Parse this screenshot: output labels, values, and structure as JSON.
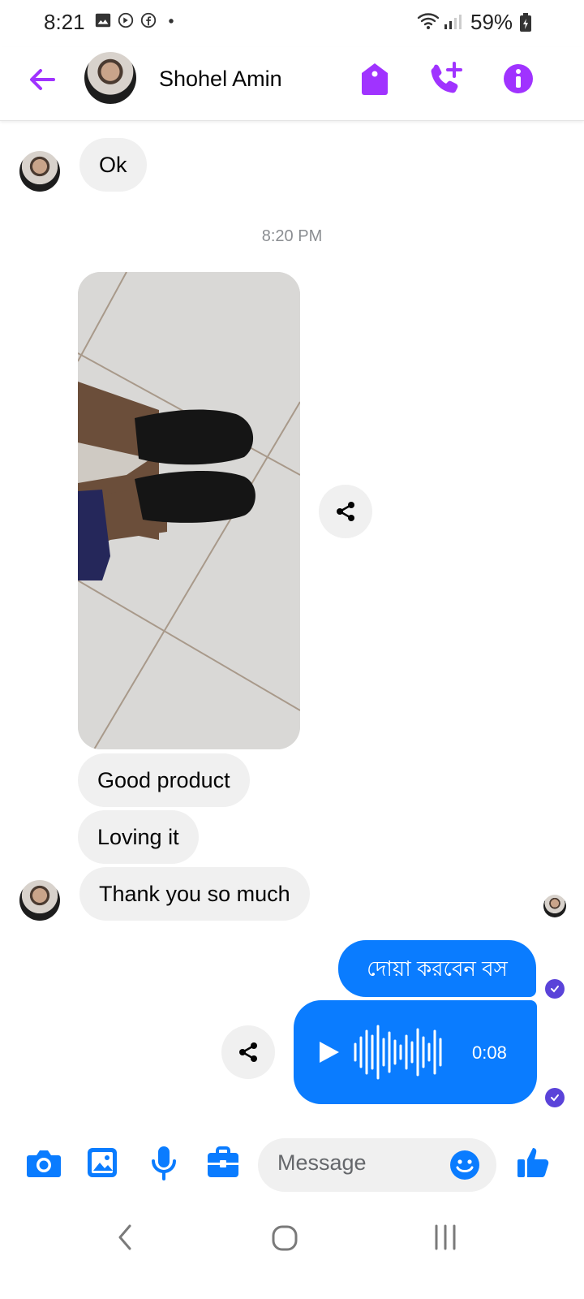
{
  "status_bar": {
    "time": "8:21",
    "battery": "59%"
  },
  "header": {
    "contact_name": "Shohel Amin"
  },
  "messages": [
    {
      "text": "Ok"
    },
    {
      "timestamp": "8:20 PM"
    },
    {
      "text": "Good product"
    },
    {
      "text": "Loving it"
    },
    {
      "text": "Thank you so much"
    },
    {
      "text": "দোয়া করবেন বস"
    },
    {
      "audio_duration": "0:08"
    }
  ],
  "composer": {
    "placeholder": "Message"
  },
  "colors": {
    "accent_purple": "#a033ff",
    "bubble_blue": "#0a7cff",
    "read_check": "#5a43d9",
    "incoming_bubble": "#f0f0f0"
  },
  "icons": [
    "back-arrow-icon",
    "tag-icon",
    "add-call-icon",
    "info-icon",
    "share-icon",
    "play-icon",
    "camera-icon",
    "gallery-icon",
    "microphone-icon",
    "briefcase-icon",
    "emoji-icon",
    "thumbs-up-icon",
    "nav-back-icon",
    "nav-home-icon",
    "nav-recents-icon"
  ]
}
